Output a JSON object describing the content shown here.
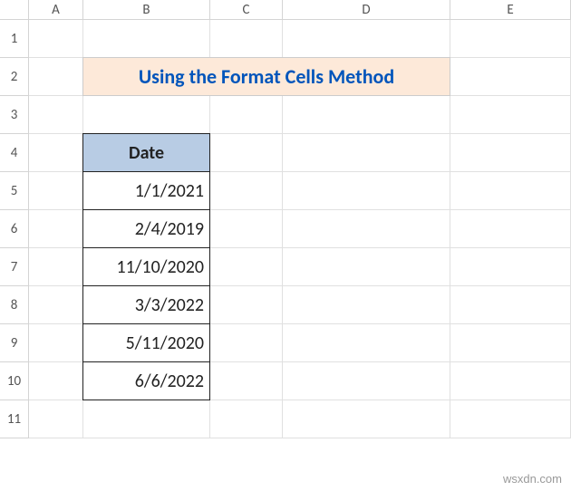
{
  "columns": [
    "A",
    "B",
    "C",
    "D",
    "E"
  ],
  "rows": [
    "1",
    "2",
    "3",
    "4",
    "5",
    "6",
    "7",
    "8",
    "9",
    "10",
    "11"
  ],
  "title": "Using the Format Cells Method",
  "table": {
    "header": "Date",
    "values": [
      "1/1/2021",
      "2/4/2019",
      "11/10/2020",
      "3/3/2022",
      "5/11/2020",
      "6/6/2022"
    ]
  },
  "watermark": "wsxdn.com"
}
